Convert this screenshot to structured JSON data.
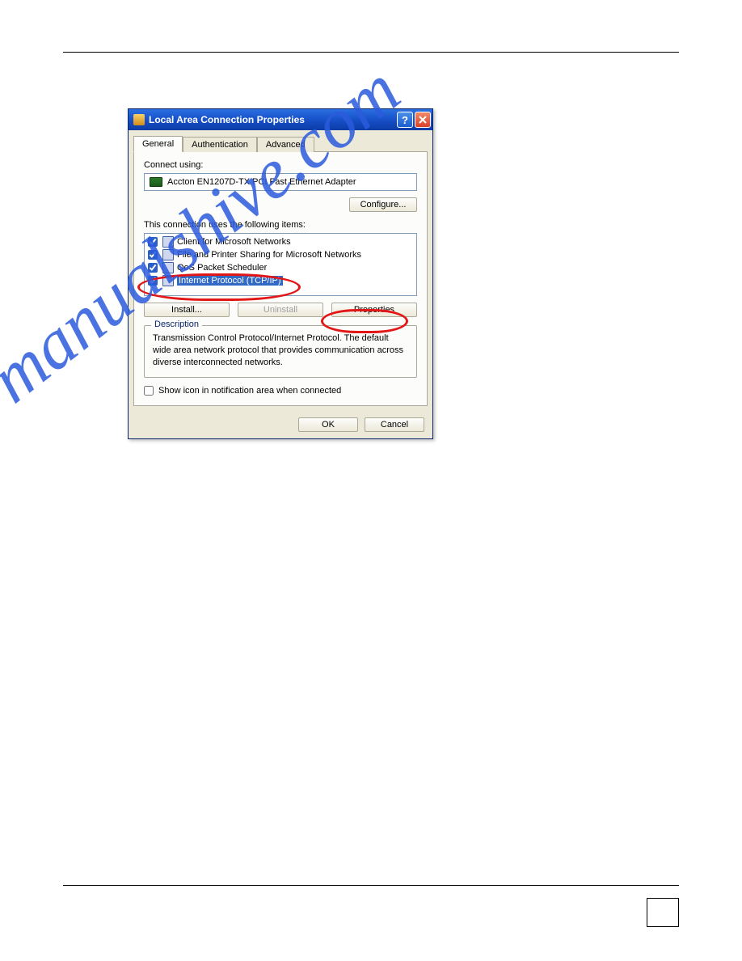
{
  "dialog": {
    "title": "Local Area Connection Properties",
    "tabs": {
      "general": "General",
      "auth": "Authentication",
      "adv": "Advanced"
    },
    "connect_using_label": "Connect using:",
    "adapter": "Accton EN1207D-TX PCI Fast Ethernet Adapter",
    "configure_btn": "Configure...",
    "items_label": "This connection uses the following items:",
    "items": [
      "Client for Microsoft Networks",
      "File and Printer Sharing for Microsoft Networks",
      "QoS Packet Scheduler",
      "Internet Protocol (TCP/IP)"
    ],
    "install_btn": "Install...",
    "uninstall_btn": "Uninstall",
    "properties_btn": "Properties",
    "desc_legend": "Description",
    "desc_text": "Transmission Control Protocol/Internet Protocol. The default wide area network protocol that provides communication across diverse interconnected networks.",
    "showicon_label": "Show icon in notification area when connected",
    "ok_btn": "OK",
    "cancel_btn": "Cancel"
  },
  "watermark": "manualshive.com"
}
